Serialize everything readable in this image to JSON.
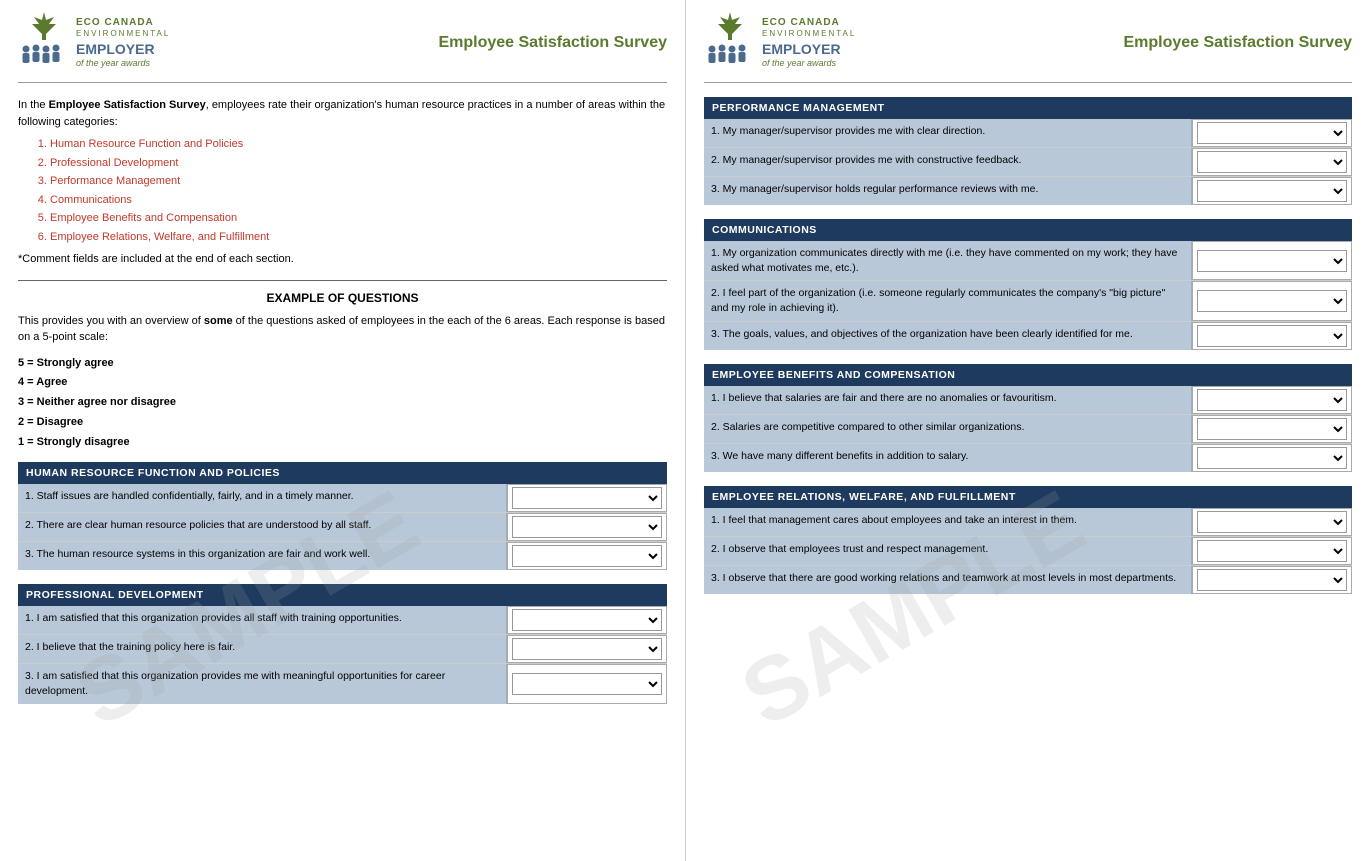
{
  "left_page": {
    "logo": {
      "eco": "ECO CANADA",
      "environmental": "ENVIRONMENTAL",
      "employer": "EMPLOYER",
      "year": "of the year awards"
    },
    "survey_title": "Employee Satisfaction Survey",
    "intro_text_1": "In the ",
    "intro_bold_1": "Employee Satisfaction Survey",
    "intro_text_2": ", employees rate their organization's human resource practices in a number of areas within the following categories:",
    "categories": [
      "Human Resource Function and Policies",
      "Professional Development",
      "Performance Management",
      "Communications",
      "Employee Benefits and Compensation",
      "Employee Relations, Welfare, and Fulfillment"
    ],
    "note": "*Comment fields are included at the end of each section.",
    "example_title": "EXAMPLE OF QUESTIONS",
    "example_intro_1": "This provides you with an overview of ",
    "example_bold": "some",
    "example_intro_2": " of the questions asked of employees in the each of the 6 areas. Each response is based on a 5-point scale:",
    "scale": [
      "5 = Strongly agree",
      "4 = Agree",
      "3 = Neither agree nor disagree",
      "2 = Disagree",
      "1 = Strongly disagree"
    ],
    "sections": [
      {
        "id": "hr_function",
        "header": "HUMAN RESOURCE FUNCTION AND POLICIES",
        "questions": [
          "1. Staff issues are handled confidentially, fairly, and in a timely manner.",
          "2. There are clear human resource policies that are understood by all staff.",
          "3. The human resource systems in this organization are fair and work well."
        ]
      },
      {
        "id": "prof_dev",
        "header": "PROFESSIONAL DEVELOPMENT",
        "questions": [
          "1. I am satisfied that this organization provides all staff with training opportunities.",
          "2. I believe that the training policy here is fair.",
          "3. I am satisfied that this organization provides me with meaningful opportunities for career development."
        ]
      }
    ],
    "watermark": "SAMPLE"
  },
  "right_page": {
    "logo": {
      "eco": "ECO CANADA",
      "environmental": "ENVIRONMENTAL",
      "employer": "EMPLOYER",
      "year": "of the year awards"
    },
    "survey_title": "Employee Satisfaction Survey",
    "sections": [
      {
        "id": "perf_mgmt",
        "header": "PERFORMANCE MANAGEMENT",
        "questions": [
          "1. My manager/supervisor provides me with clear direction.",
          "2. My manager/supervisor provides me with constructive feedback.",
          "3. My manager/supervisor holds regular performance reviews with me."
        ]
      },
      {
        "id": "communications",
        "header": "COMMUNICATIONS",
        "questions": [
          "1. My organization communicates directly with me (i.e. they have commented on my work; they have asked what motivates me, etc.).",
          "2. I feel part of the organization (i.e. someone regularly communicates the company's \"big picture\" and my role in achieving it).",
          "3. The goals, values, and objectives of the organization have been clearly identified for me."
        ]
      },
      {
        "id": "benefits",
        "header": "EMPLOYEE BENEFITS AND COMPENSATION",
        "questions": [
          "1. I believe that salaries are fair and there are no anomalies or favouritism.",
          "2. Salaries are competitive compared to other similar organizations.",
          "3. We have many different benefits in addition to salary."
        ]
      },
      {
        "id": "employee_relations",
        "header": "EMPLOYEE RELATIONS, WELFARE, AND FULFILLMENT",
        "questions": [
          "1. I feel that management cares about employees and take an interest in them.",
          "2. I observe that employees trust and respect management.",
          "3. I observe that there are good working relations and teamwork at most levels in most departments."
        ]
      }
    ],
    "watermark": "SAMPLE"
  }
}
